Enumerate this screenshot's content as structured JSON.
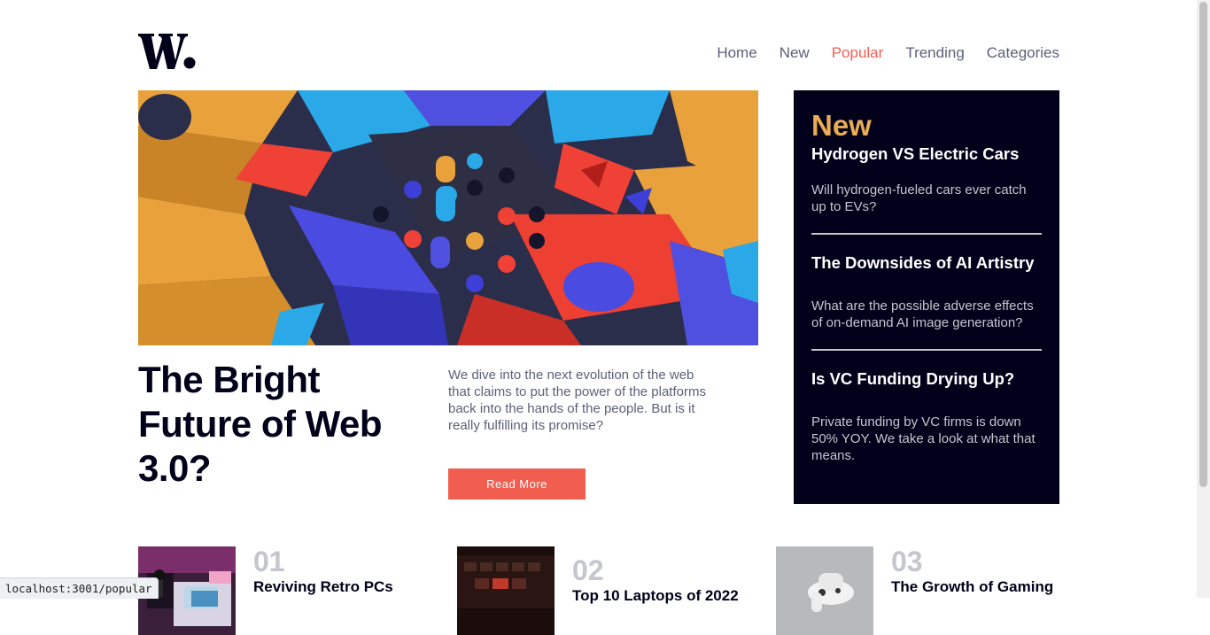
{
  "header": {
    "logo_text": "W.",
    "nav": [
      {
        "label": "Home",
        "active": false
      },
      {
        "label": "New",
        "active": false
      },
      {
        "label": "Popular",
        "active": true
      },
      {
        "label": "Trending",
        "active": false
      },
      {
        "label": "Categories",
        "active": false
      }
    ]
  },
  "hero": {
    "title": "The Bright Future of Web 3.0?",
    "description": "We dive into the next evolution of the web that claims to put the power of the platforms back into the hands of the people. But is it really fulfilling its promise?",
    "button_label": "Read More"
  },
  "new_panel": {
    "heading": "New",
    "items": [
      {
        "title": "Hydrogen VS Electric Cars",
        "summary": "Will hydrogen-fueled cars ever catch up to EVs?"
      },
      {
        "title": "The Downsides of AI Artistry",
        "summary": "What are the possible adverse effects of on-demand AI image generation?"
      },
      {
        "title": "Is VC Funding Drying Up?",
        "summary": "Private funding by VC firms is down 50% YOY. We take a look at what that means."
      }
    ]
  },
  "cards": [
    {
      "number": "01",
      "title": "Reviving Retro PCs"
    },
    {
      "number": "02",
      "title": "Top 10 Laptops of 2022"
    },
    {
      "number": "03",
      "title": "The Growth of Gaming"
    }
  ],
  "status_bar": {
    "url": "localhost:3001/popular"
  },
  "colors": {
    "accent": "#f15e50",
    "new_heading": "#e9ab53",
    "dark": "#00001a",
    "muted": "#5d5f79",
    "light_gray": "#c5c6ce"
  }
}
